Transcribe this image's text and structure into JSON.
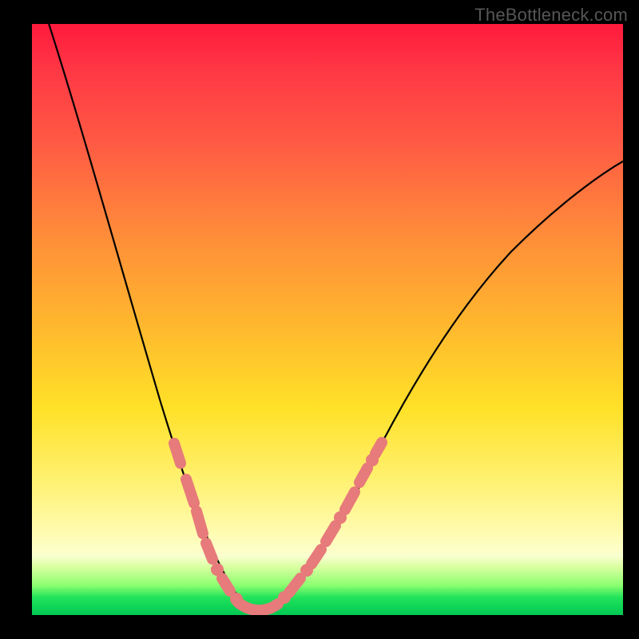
{
  "watermark": "TheBottleneck.com",
  "colors": {
    "gradient_top": "#ff1a3c",
    "gradient_mid": "#ffe128",
    "gradient_bottom": "#00c853",
    "curve": "#000000",
    "overlay_pink": "#e77a7a",
    "frame": "#000000"
  },
  "chart_data": {
    "type": "line",
    "title": "",
    "xlabel": "",
    "ylabel": "",
    "xlim": [
      0,
      100
    ],
    "ylim": [
      0,
      100
    ],
    "series": [
      {
        "name": "bottleneck-curve",
        "x": [
          2,
          6,
          10,
          14,
          18,
          22,
          26,
          28,
          30,
          32,
          34,
          36,
          38,
          42,
          46,
          50,
          54,
          58,
          62,
          66,
          70,
          74,
          78,
          82,
          86,
          90,
          94,
          98,
          100
        ],
        "y": [
          100,
          90,
          78,
          66,
          54,
          42,
          30,
          24,
          18,
          12,
          6,
          2,
          0,
          2,
          6,
          12,
          20,
          28,
          36,
          44,
          50,
          56,
          62,
          66,
          70,
          74,
          76,
          79,
          80
        ]
      }
    ],
    "annotations": [
      {
        "name": "optimal-range-overlay",
        "color": "#e77a7a",
        "x_start": 24,
        "x_end": 50,
        "note": "pink marker band along curve near minimum"
      }
    ],
    "grid": false,
    "legend": false
  }
}
